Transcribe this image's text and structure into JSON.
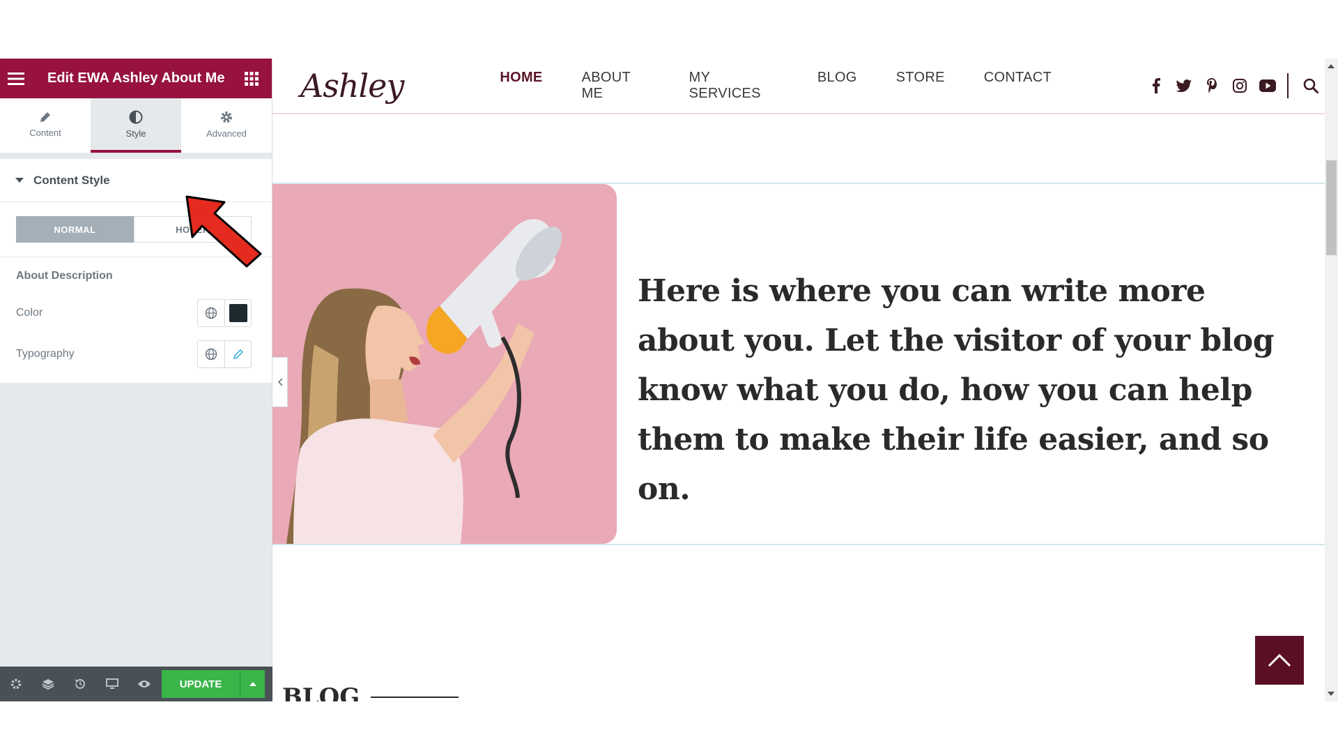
{
  "panel": {
    "title": "Edit EWA Ashley About Me",
    "accent": "#97123e",
    "tabs": [
      {
        "label": "Content",
        "icon": "pencil-icon"
      },
      {
        "label": "Style",
        "icon": "contrast-icon"
      },
      {
        "label": "Advanced",
        "icon": "gear-icon"
      }
    ],
    "active_tab": "Style",
    "section_title": "Content Style",
    "states": {
      "normal": "NORMAL",
      "hover": "HOVER",
      "active": "NORMAL"
    },
    "controls_heading": "About Description",
    "controls": [
      {
        "label": "Color",
        "value_color": "#1f2a30"
      },
      {
        "label": "Typography"
      }
    ],
    "footer": {
      "update_label": "UPDATE",
      "update_color": "#39b54a"
    }
  },
  "site": {
    "logo": "Ashley",
    "nav": [
      "HOME",
      "ABOUT ME",
      "MY SERVICES",
      "BLOG",
      "STORE",
      "CONTACT"
    ],
    "nav_active": "HOME",
    "social_icons": [
      "facebook-icon",
      "twitter-icon",
      "pinterest-icon",
      "instagram-icon",
      "youtube-icon"
    ],
    "about_text": "Here is where you can write more about you. Let the visitor of your blog know what you do, how you can help them to make their life easier, and so on.",
    "blog_heading": "BLOG",
    "brand_color": "#5a0f24"
  }
}
